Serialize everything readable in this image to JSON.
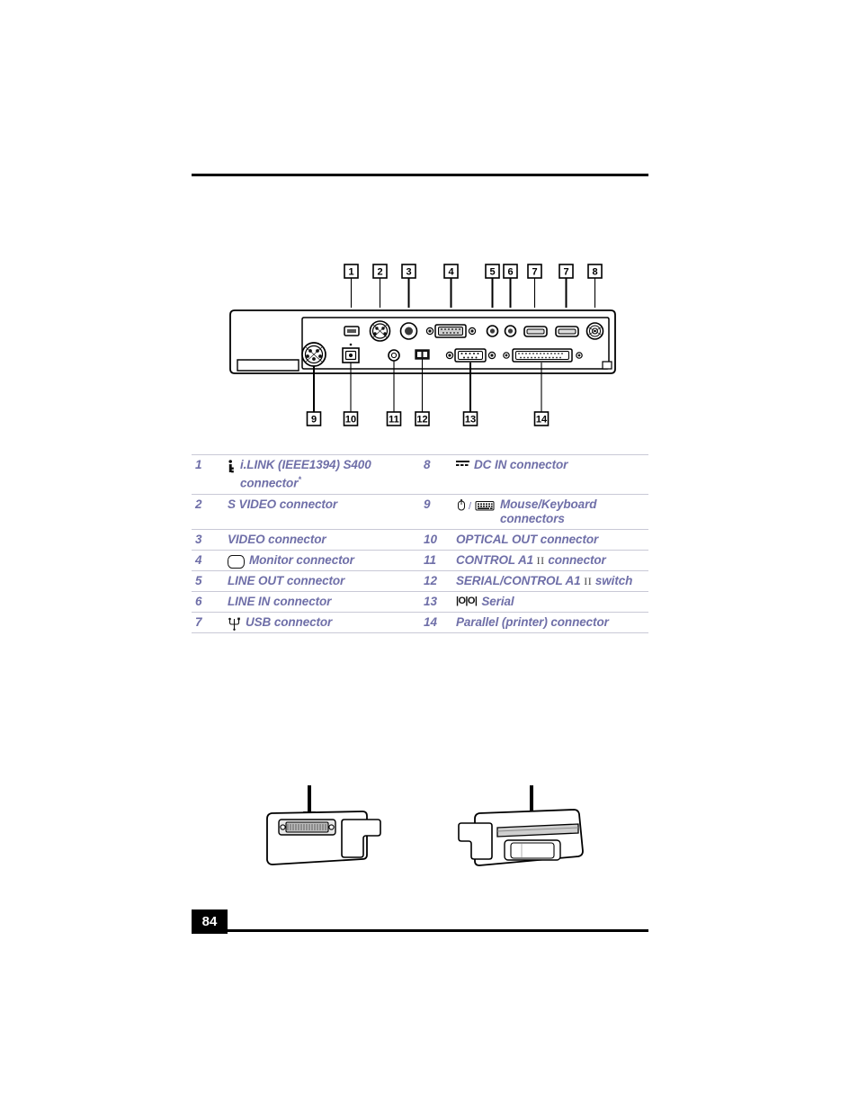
{
  "page": {
    "number": "84",
    "top_rule": true
  },
  "diagram": {
    "name": "docking-station-rear-connector-panel",
    "callouts_top": [
      "1",
      "2",
      "3",
      "4",
      "5",
      "6",
      "7",
      "7",
      "8"
    ],
    "callouts_bottom": [
      "9",
      "10",
      "11",
      "12",
      "13",
      "14"
    ]
  },
  "legend": {
    "rows": [
      {
        "left": {
          "num": "1",
          "icon": "ilink-icon",
          "text": "i.LINK (IEEE1394) S400 connector",
          "footnote": "*"
        },
        "right": {
          "num": "8",
          "icon": "dc-in-icon",
          "text": "DC IN connector"
        }
      },
      {
        "left": {
          "num": "2",
          "icon": "",
          "text": "S VIDEO connector"
        },
        "right": {
          "num": "9",
          "icon": "mouse-keyboard-icon",
          "text": "Mouse/Keyboard connectors"
        }
      },
      {
        "left": {
          "num": "3",
          "icon": "",
          "text": "VIDEO connector"
        },
        "right": {
          "num": "10",
          "icon": "",
          "text": "OPTICAL OUT connector"
        }
      },
      {
        "left": {
          "num": "4",
          "icon": "monitor-icon",
          "text": "Monitor connector"
        },
        "right": {
          "num": "11",
          "icon": "",
          "text_pre": "CONTROL A1",
          "roman": "II",
          "text_post": "connector"
        }
      },
      {
        "left": {
          "num": "5",
          "icon": "",
          "text": "LINE OUT connector"
        },
        "right": {
          "num": "12",
          "icon": "",
          "text_pre": "SERIAL/CONTROL A1",
          "roman": "II",
          "text_post": "switch"
        }
      },
      {
        "left": {
          "num": "6",
          "icon": "",
          "text": "LINE IN connector"
        },
        "right": {
          "num": "13",
          "icon": "serial-icon",
          "icon_text": "|O|O|",
          "text": "Serial"
        }
      },
      {
        "left": {
          "num": "7",
          "icon": "usb-icon",
          "text": "USB connector"
        },
        "right": {
          "num": "14",
          "icon": "",
          "text": "Parallel (printer) connector"
        }
      }
    ]
  },
  "bottom_figures": {
    "left": {
      "name": "device-side-view-with-connector",
      "arrow": "down-arrow"
    },
    "right": {
      "name": "device-side-view-with-slot",
      "arrow": "down-arrow"
    }
  },
  "colors": {
    "legend_text": "#6f6fa8",
    "rule": "#000000",
    "row_divider": "#c9c9d6",
    "page_box_bg": "#000000",
    "page_box_fg": "#ffffff"
  }
}
